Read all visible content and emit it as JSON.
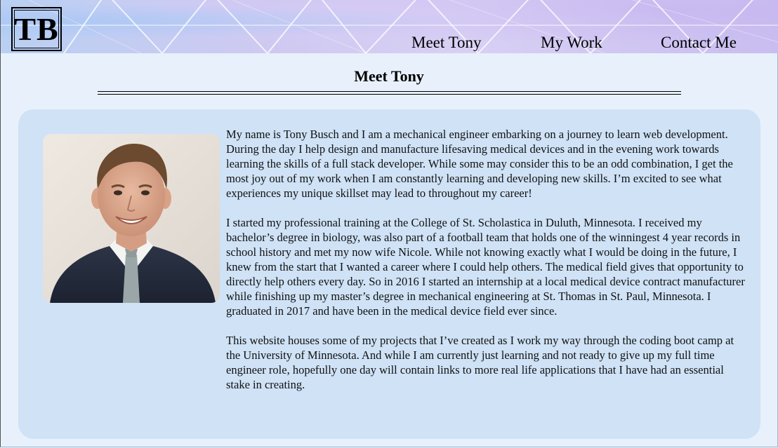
{
  "logo": {
    "text": "TB"
  },
  "nav": {
    "items": [
      {
        "label": "Meet Tony"
      },
      {
        "label": "My Work"
      },
      {
        "label": "Contact Me"
      }
    ]
  },
  "section": {
    "title": "Meet Tony"
  },
  "about": {
    "photo_alt": "Portrait of Tony Busch",
    "paragraphs": [
      "My name is Tony Busch and I am a mechanical engineer embarking on a journey to learn web development. During the day I help design and manufacture lifesaving medical devices and in the evening work towards learning the skills of a full stack developer. While some may consider this to be an odd combination, I get the most joy out of my work when I am constantly learning and developing new skills. I’m excited to see what experiences my unique skillset may lead to throughout my career!",
      "I started my professional training at the College of St. Scholastica in Duluth, Minnesota. I received my bachelor’s degree in biology, was also part of a football team that holds one of the winningest 4 year records in school history and met my now wife Nicole. While not knowing exactly what I would be doing in the future, I knew from the start that I wanted a career where I could help others. The medical field gives that opportunity to directly help others every day. So in 2016 I started an internship at a local medical device contract manufacturer while finishing up my master’s degree in mechanical engineering at St. Thomas in St. Paul, Minnesota. I graduated in 2017 and have been in the medical device field ever since.",
      "This website houses some of my projects that I’ve created as I work my way through the coding boot camp at the University of Minnesota. And while I am currently just learning and not ready to give up my full time engineer role, hopefully one day will contain links to more real life applications that I have had an essential stake in creating."
    ]
  },
  "colors": {
    "page_background": "#e8f1fb",
    "card_background": "#cfe2f6",
    "header_gradient_start": "#b9d0f3",
    "header_gradient_end": "#c9bdf0",
    "text": "#111111"
  }
}
